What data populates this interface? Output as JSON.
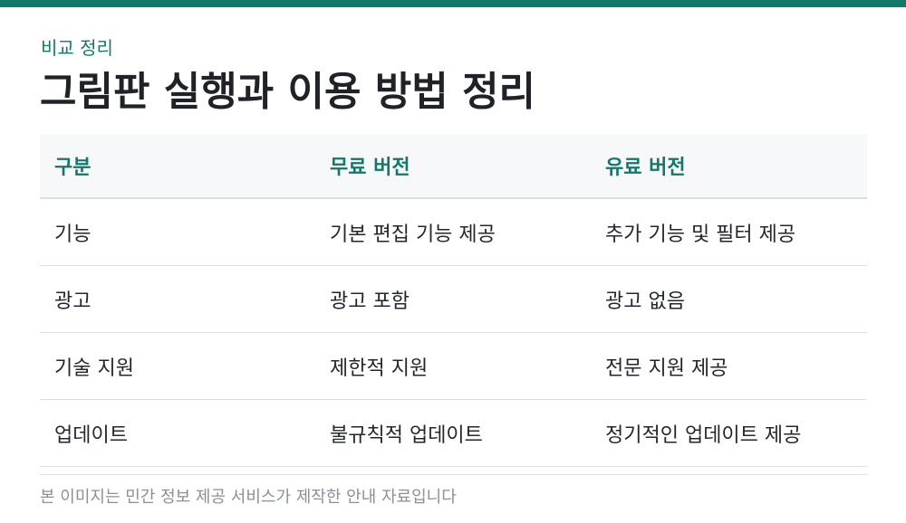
{
  "header": {
    "eyebrow": "비교 정리",
    "title": "그림판 실행과 이용 방법 정리"
  },
  "table": {
    "columns": [
      "구분",
      "무료 버전",
      "유료 버전"
    ],
    "rows": [
      [
        "기능",
        "기본 편집 기능 제공",
        "추가 기능 및 필터 제공"
      ],
      [
        "광고",
        "광고 포함",
        "광고 없음"
      ],
      [
        "기술 지원",
        "제한적 지원",
        "전문 지원 제공"
      ],
      [
        "업데이트",
        "불규칙적 업데이트",
        "정기적인 업데이트 제공"
      ]
    ]
  },
  "footer": {
    "note": "본 이미지는 민간 정보 제공 서비스가 제작한 안내 자료입니다"
  },
  "colors": {
    "accent": "#13776a",
    "header_bg": "#f6f8fa",
    "text": "#1f2329",
    "muted": "#8a9098",
    "border": "#dcdfe3"
  }
}
